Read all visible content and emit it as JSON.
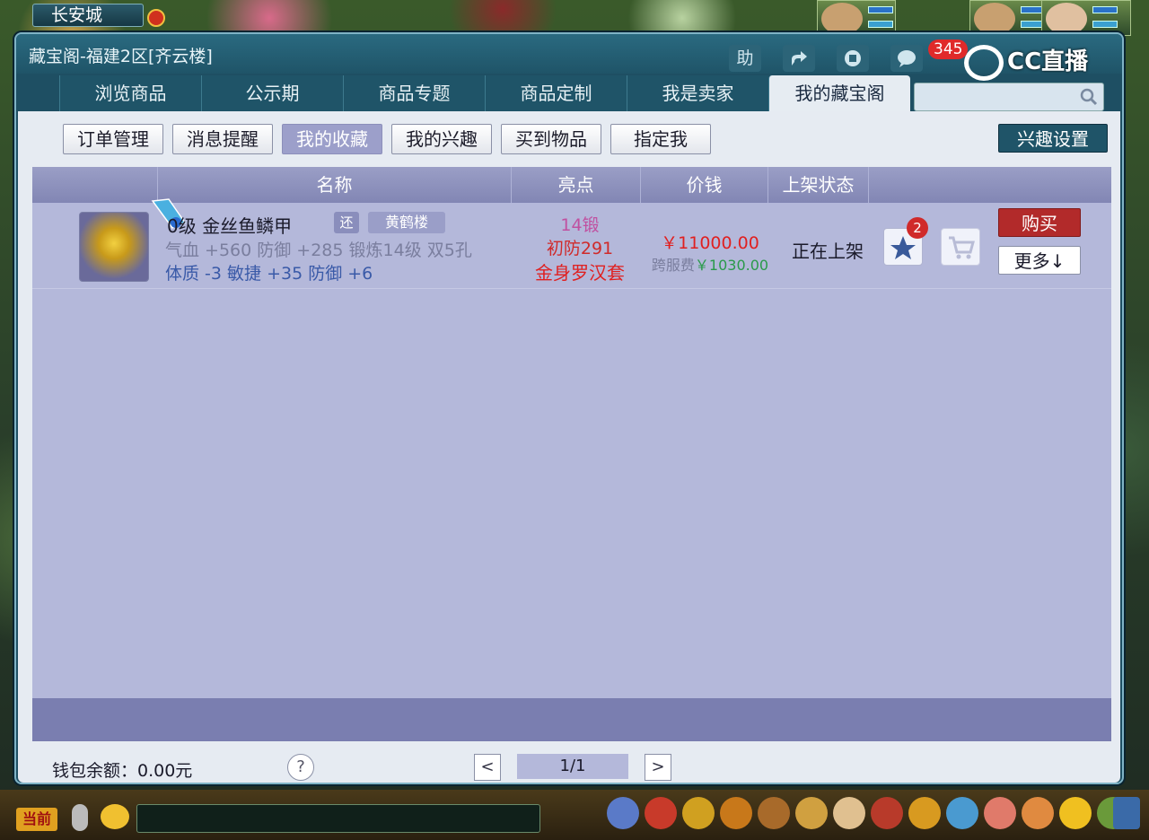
{
  "game": {
    "location": "长安城"
  },
  "window": {
    "title": "藏宝阁-福建2区[齐云楼]",
    "help_label": "助",
    "message_count": "345",
    "watermark": "CC直播"
  },
  "tabs": [
    {
      "label": "浏览商品"
    },
    {
      "label": "公示期"
    },
    {
      "label": "商品专题"
    },
    {
      "label": "商品定制"
    },
    {
      "label": "我是卖家"
    },
    {
      "label": "我的藏宝阁"
    }
  ],
  "search": {
    "placeholder": ""
  },
  "subtabs": [
    {
      "label": "订单管理"
    },
    {
      "label": "消息提醒"
    },
    {
      "label": "我的收藏"
    },
    {
      "label": "我的兴趣"
    },
    {
      "label": "买到物品"
    },
    {
      "label": "指定我"
    }
  ],
  "interest_settings_label": "兴趣设置",
  "table": {
    "headers": {
      "name": "名称",
      "highlight": "亮点",
      "price": "价钱",
      "status": "上架状态"
    },
    "rows": [
      {
        "level_name": "0级  金丝鱼鳞甲",
        "tag_small": "还",
        "tag_server": "黄鹤楼",
        "attr_line1": "气血 +560 防御 +285 锻炼14级 双5孔",
        "attr_line2": "体质 -3 敏捷 +35 防御 +6",
        "highlight1": "14锻",
        "highlight2": "初防291",
        "highlight3": "金身罗汉套",
        "price": "￥11000.00",
        "fee_label": "跨服费",
        "fee_amount": "￥1030.00",
        "status": "正在上架",
        "fav_count": "2",
        "buy_label": "购买",
        "more_label": "更多↓"
      }
    ]
  },
  "footer": {
    "wallet": "钱包余额：0.00元",
    "help": "?",
    "prev": "<",
    "page": "1/1",
    "next": ">"
  },
  "bottom_bar": {
    "current_label": "当前"
  },
  "colors": {
    "window_bg": "#1e4f63",
    "panel_bg": "#e6ebf2",
    "table_bg": "#b4b8da",
    "header_bg": "#8286b4",
    "buy_red": "#b22a2a",
    "price_red": "#e02020"
  }
}
